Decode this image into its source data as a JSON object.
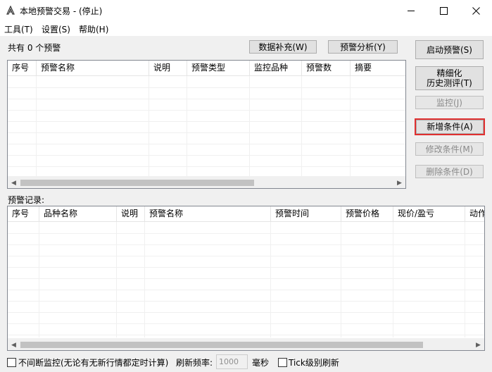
{
  "window": {
    "title": "本地预警交易 - (停止)"
  },
  "menu": [
    "工具(T)",
    "设置(S)",
    "帮助(H)"
  ],
  "summary": {
    "count_text": "共有 0 个预警"
  },
  "toolbar": {
    "supplement_label": "数据补充(W)",
    "analysis_label": "预警分析(Y)"
  },
  "side_buttons": {
    "start": "启动预警(S)",
    "backtest_line1": "精细化",
    "backtest_line2": "历史测评(T)",
    "monitor": "监控(J)",
    "add": "新增条件(A)",
    "modify": "修改条件(M)",
    "delete": "删除条件(D)"
  },
  "alert_table": {
    "columns": [
      "序号",
      "预警名称",
      "说明",
      "预警类型",
      "监控品种",
      "预警数",
      "摘要"
    ],
    "rows": []
  },
  "records": {
    "label": "预警记录:",
    "columns": [
      "序号",
      "品种名称",
      "说明",
      "预警名称",
      "预警时间",
      "预警价格",
      "现价/盈亏",
      "动作"
    ],
    "rows": []
  },
  "footer": {
    "continuous_label": "不间断监控(无论有无新行情都定时计算)",
    "refresh_label": "刷新频率:",
    "refresh_value": "1000",
    "unit_label": "毫秒",
    "tick_label": "Tick级别刷新"
  },
  "colors": {
    "focus_outline": "#e03030",
    "window_bg": "#f0f0f0"
  },
  "icons": [
    "app-icon",
    "minimize-icon",
    "maximize-icon",
    "close-icon",
    "scroll-left-icon",
    "scroll-right-icon"
  ]
}
